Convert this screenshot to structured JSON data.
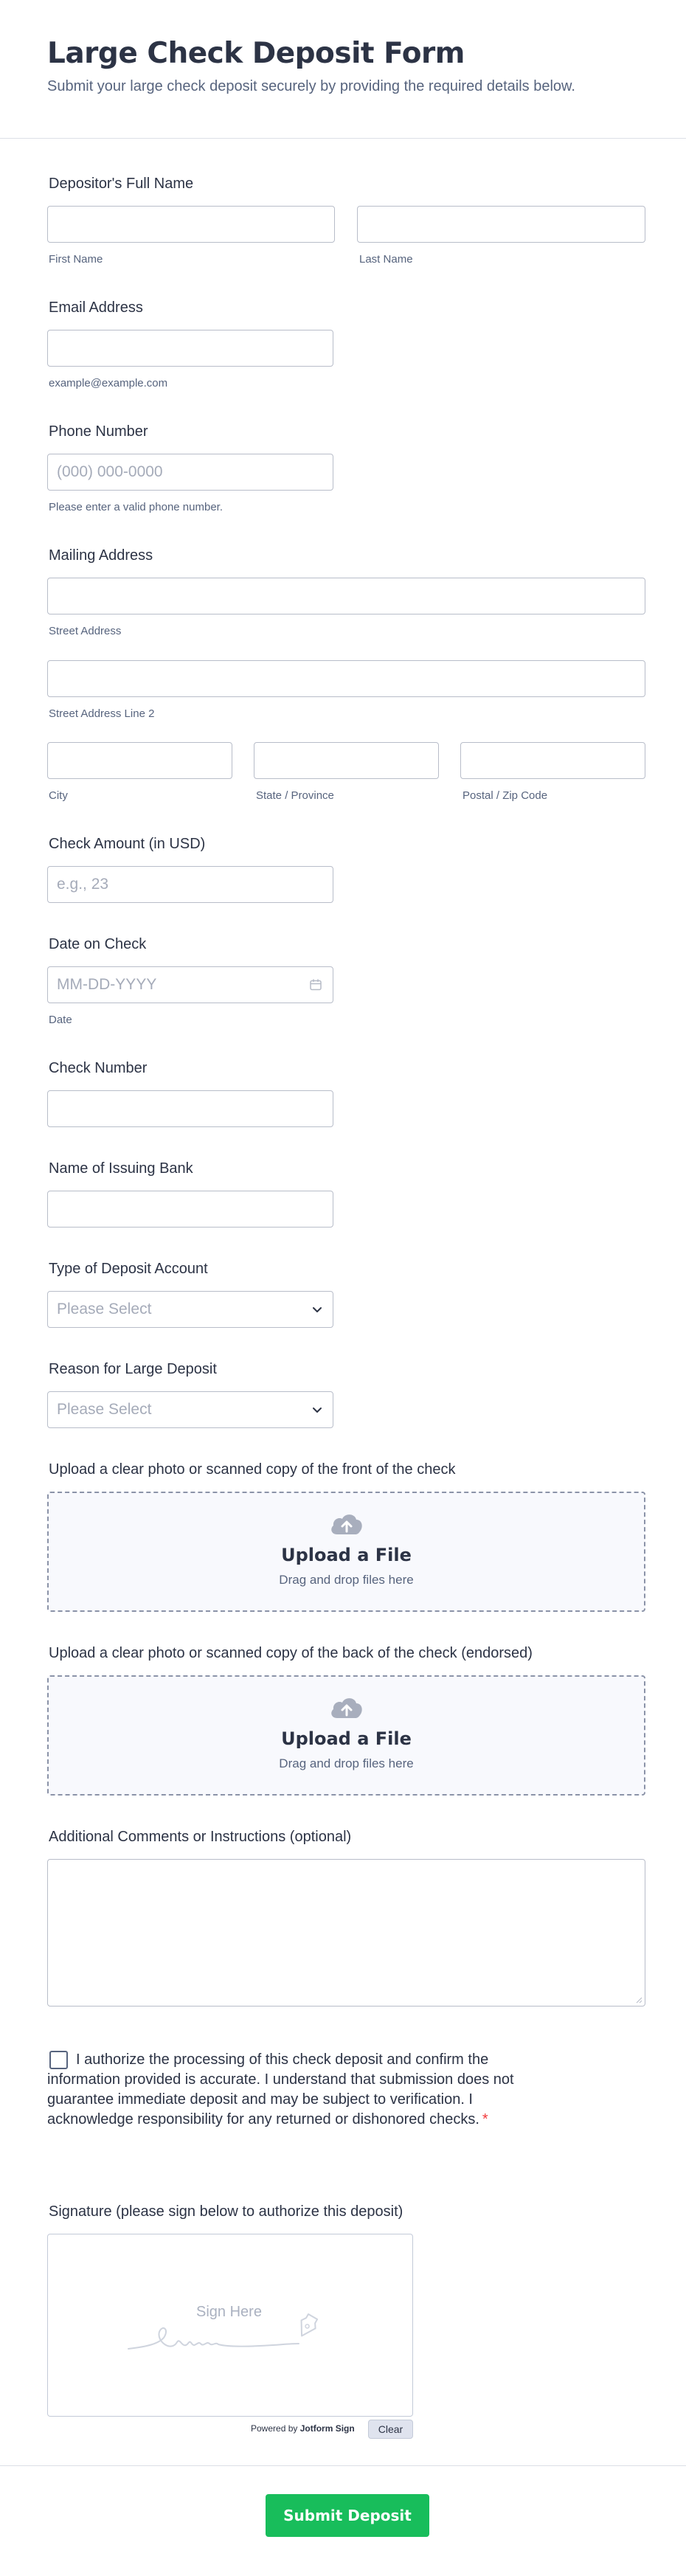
{
  "header": {
    "title": "Large Check Deposit Form",
    "subtitle": "Submit your large check deposit securely by providing the required details below."
  },
  "fields": {
    "name": {
      "label": "Depositor's Full Name",
      "first": "First Name",
      "last": "Last Name"
    },
    "email": {
      "label": "Email Address",
      "sublabel": "example@example.com"
    },
    "phone": {
      "label": "Phone Number",
      "placeholder": "(000) 000-0000",
      "sublabel": "Please enter a valid phone number."
    },
    "address": {
      "label": "Mailing Address",
      "street": "Street Address",
      "street2": "Street Address Line 2",
      "city": "City",
      "state": "State / Province",
      "zip": "Postal / Zip Code"
    },
    "amount": {
      "label": "Check Amount (in USD)",
      "placeholder": "e.g., 23"
    },
    "date": {
      "label": "Date on Check",
      "placeholder": "MM-DD-YYYY",
      "sublabel": "Date"
    },
    "check_number": {
      "label": "Check Number"
    },
    "bank": {
      "label": "Name of Issuing Bank"
    },
    "account_type": {
      "label": "Type of Deposit Account",
      "placeholder": "Please Select"
    },
    "reason": {
      "label": "Reason for Large Deposit",
      "placeholder": "Please Select"
    },
    "upload_front": {
      "label": "Upload a clear photo or scanned copy of the front of the check",
      "title": "Upload a File",
      "hint": "Drag and drop files here"
    },
    "upload_back": {
      "label": "Upload a clear photo or scanned copy of the back of the check (endorsed)",
      "title": "Upload a File",
      "hint": "Drag and drop files here"
    },
    "comments": {
      "label": "Additional Comments or Instructions (optional)"
    },
    "consent": {
      "line1": "I authorize the processing of this check deposit and confirm the",
      "line2": "information provided is accurate. I understand that submission does not",
      "line3": "guarantee immediate deposit and may be subject to verification. I",
      "line4": "acknowledge responsibility for any returned or dishonored checks.",
      "required_mark": "*"
    },
    "signature": {
      "label": "Signature (please sign below to authorize this deposit)",
      "hint": "Sign Here",
      "powered_prefix": "Powered by",
      "powered_brand": "Jotform Sign",
      "clear": "Clear"
    }
  },
  "submit": {
    "label": "Submit Deposit"
  },
  "colors": {
    "accent": "#18bd5b",
    "required": "#f23a3c",
    "text": "#2c3345",
    "muted": "#57647e"
  }
}
